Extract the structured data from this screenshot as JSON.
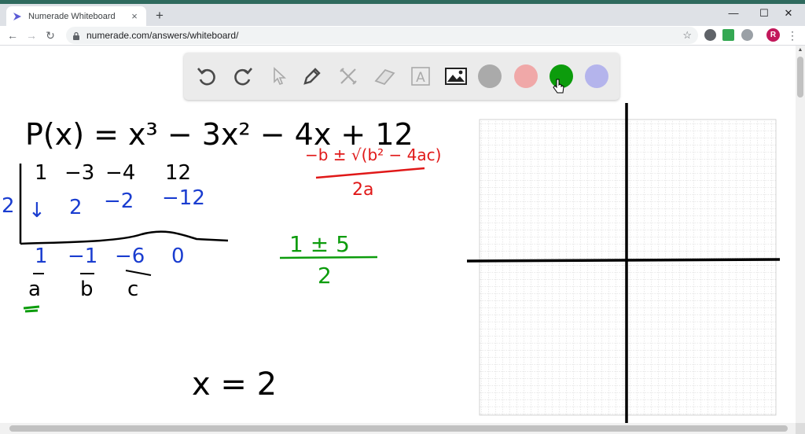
{
  "browser": {
    "tab_title": "Numerade Whiteboard",
    "tab_close": "×",
    "new_tab": "+",
    "url": "numerade.com/answers/whiteboard/",
    "profile_initial": "R",
    "window_minimize": "—",
    "window_maximize": "☐",
    "window_close": "✕",
    "back": "←",
    "forward": "→",
    "reload": "↻",
    "bookmark_star": "☆",
    "menu": "⋮"
  },
  "palette": {
    "tools": [
      "undo-icon",
      "redo-icon",
      "select-icon",
      "pen-icon",
      "tools-icon",
      "eraser-icon",
      "text-icon",
      "image-icon"
    ],
    "text_tool_glyph": "A",
    "colors": [
      "#aaaaaa",
      "#f0a8a8",
      "#0c9c0c",
      "#b4b4ec"
    ]
  },
  "board": {
    "equation": "P(x) = x³ − 3x² − 4x + 12",
    "synthetic_coeffs": [
      "1",
      "−3",
      "−4",
      "12"
    ],
    "synthetic_divisor": "2",
    "synthetic_products": [
      "↓",
      "2",
      "−2",
      "−12"
    ],
    "synthetic_results": [
      "1",
      "−1",
      "−6",
      "0"
    ],
    "abc_labels": [
      "a",
      "b",
      "c"
    ],
    "quadratic_formula_top": "−b ± √(b² − 4ac)",
    "quadratic_formula_bottom": "2a",
    "green_top": "1 ± 5",
    "green_bottom": "2",
    "root_text": "x = 2"
  }
}
